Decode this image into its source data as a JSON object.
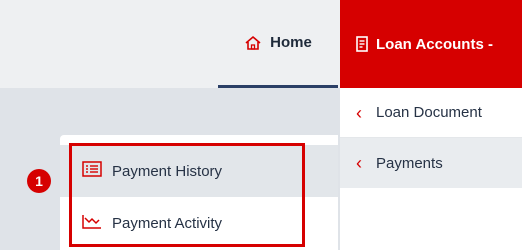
{
  "nav": {
    "home_label": "Home",
    "home_icon": "home-icon",
    "loan_accounts_label": "Loan Accounts -",
    "loan_accounts_icon": "document-icon"
  },
  "submenu": {
    "items": [
      {
        "label": "Loan Document"
      },
      {
        "label": "Payments"
      }
    ]
  },
  "payments_menu": {
    "items": [
      {
        "label": "Payment History",
        "icon": "list-icon"
      },
      {
        "label": "Payment Activity",
        "icon": "chart-trend-icon"
      }
    ]
  },
  "annotation": {
    "step_number": "1"
  },
  "colors": {
    "accent_red": "#d60000",
    "nav_underline": "#2b3f66"
  }
}
